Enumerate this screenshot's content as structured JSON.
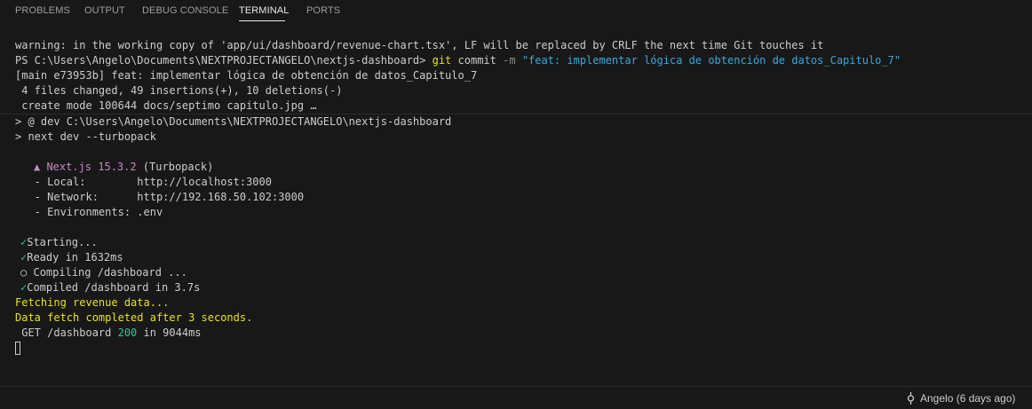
{
  "panel": {
    "tabs": [
      {
        "label": "PROBLEMS"
      },
      {
        "label": "OUTPUT"
      },
      {
        "label": "DEBUG CONSOLE"
      },
      {
        "label": "TERMINAL",
        "active": true
      },
      {
        "label": "PORTS"
      }
    ]
  },
  "terminal": {
    "git": {
      "warning": "warning: in the working copy of 'app/ui/dashboard/revenue-chart.tsx', LF will be replaced by CRLF the next time Git touches it",
      "prompt": "PS C:\\Users\\Angelo\\Documents\\NEXTPROJECTANGELO\\nextjs-dashboard>",
      "cmd_git": "git",
      "cmd_sub": "commit",
      "cmd_flag": "-m",
      "cmd_msg": "\"feat: implementar lógica de obtención de datos_Capitulo_7\"",
      "result": "[main e73953b] feat: implementar lógica de obtención de datos_Capitulo_7",
      "stats": " 4 files changed, 49 insertions(+), 10 deletions(-)",
      "create": " create mode 100644 docs/septimo capitulo.jpg …"
    },
    "dev": {
      "line1": "> @ dev C:\\Users\\Angelo\\Documents\\NEXTPROJECTANGELO\\nextjs-dashboard",
      "line2": "> next dev --turbopack",
      "next_brand": "▲ Next.js 15.3.2",
      "next_suffix": " (Turbopack)",
      "local": "   - Local:        http://localhost:3000",
      "network": "   - Network:      http://192.168.50.102:3000",
      "env": "   - Environments: .env",
      "check_glyph": "✓",
      "circle_glyph": "○",
      "starting": "Starting...",
      "ready": "Ready in 1632ms",
      "compiling": "Compiling /dashboard ...",
      "compiled": "Compiled /dashboard in 3.7s",
      "fetching": "Fetching revenue data...",
      "fetch_a": "Data ",
      "fetch_b": "fetch completed after 3 seconds.",
      "get_a": " GET /dashboard ",
      "get_status": "200",
      "get_b": " in 9044ms"
    }
  },
  "status": {
    "blame": "Angelo (6 days ago)"
  },
  "colors": {
    "background": "#181818",
    "text": "#cccccc",
    "yellow": "#e5e510",
    "cyan": "#3aa8d6",
    "magenta": "#c586c0",
    "green": "#23d18b"
  }
}
